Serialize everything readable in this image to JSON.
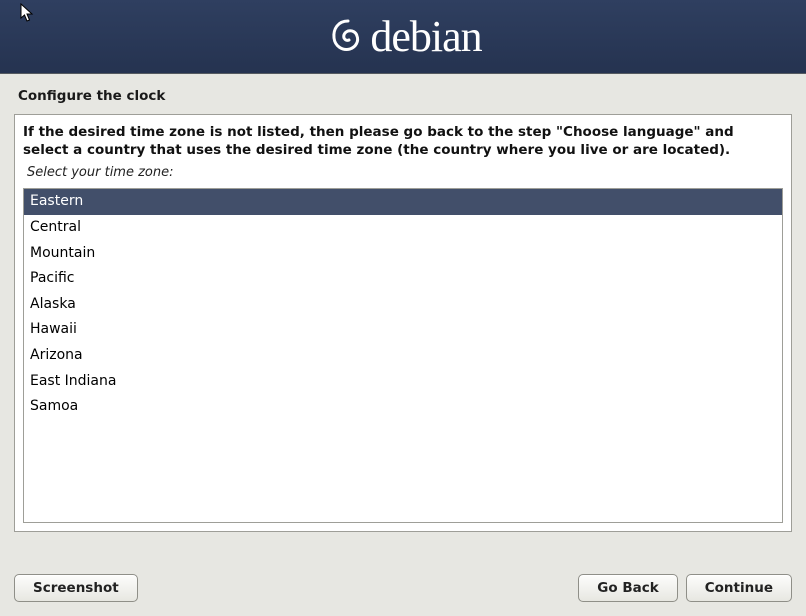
{
  "brand": {
    "name": "debian"
  },
  "page_title": "Configure the clock",
  "instruction": "If the desired time zone is not listed, then please go back to the step \"Choose language\" and select a country that uses the desired time zone (the country where you live or are located).",
  "sub_instruction": "Select your time zone:",
  "timezones": {
    "selected_index": 0,
    "items": [
      "Eastern",
      "Central",
      "Mountain",
      "Pacific",
      "Alaska",
      "Hawaii",
      "Arizona",
      "East Indiana",
      "Samoa"
    ]
  },
  "buttons": {
    "screenshot": "Screenshot",
    "go_back": "Go Back",
    "continue": "Continue"
  }
}
